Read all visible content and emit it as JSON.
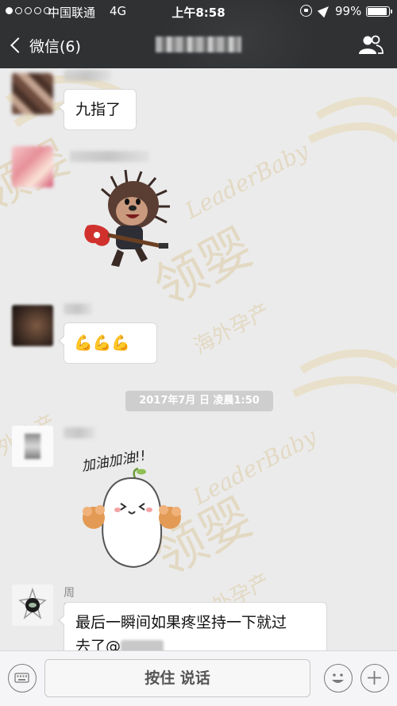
{
  "status_bar": {
    "carrier": "中国联通",
    "network": "4G",
    "time": "上午8:58",
    "battery": "99%"
  },
  "nav": {
    "back_label": "微信(6)"
  },
  "messages": {
    "m1_text": "九指了",
    "m3_text": "💪💪💪",
    "timestamp": "2017年7月 日 凌晨1:50",
    "sticker2_text": "加油加油!!",
    "m5_sender": "周波",
    "m5_line1": "最后一瞬间如果疼坚持一下就过",
    "m5_line2": "去了@"
  },
  "watermark": {
    "brand_en": "LeaderBaby",
    "brand_cn": "领婴",
    "tagline_cn": "海外孕产"
  },
  "input_bar": {
    "voice_label": "按住 说话"
  },
  "colors": {
    "topbar": "#2f3133",
    "chat_bg": "#ebebeb",
    "bubble": "#ffffff",
    "watermark_gold": "#c9a24a"
  },
  "icons": [
    "rotation-lock-icon",
    "location-arrow-icon",
    "battery-icon",
    "back-chevron-icon",
    "group-info-icon",
    "keyboard-icon",
    "emoji-icon",
    "plus-icon"
  ]
}
